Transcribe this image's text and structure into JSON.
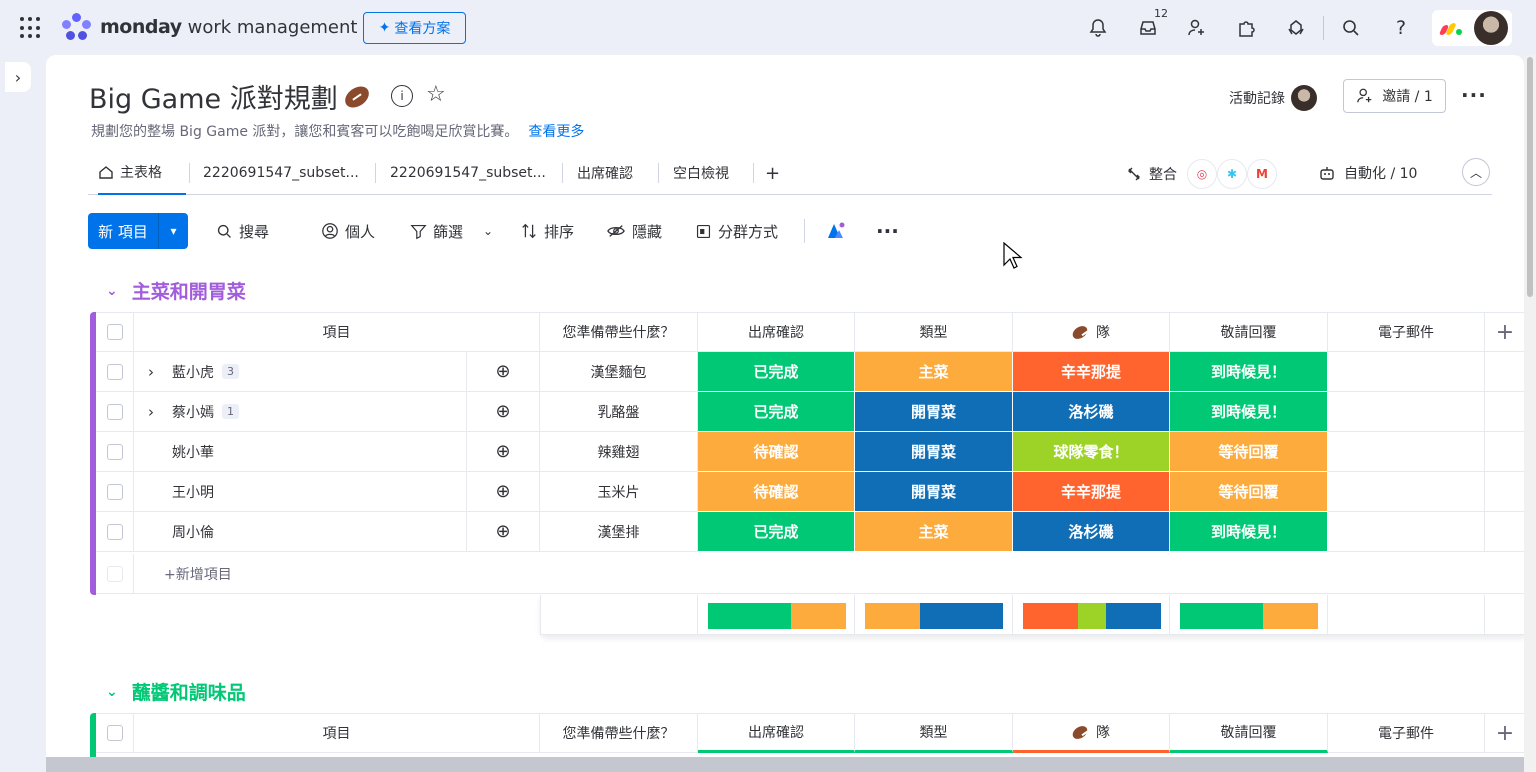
{
  "app": {
    "brand_bold": "monday",
    "brand_rest": "work management",
    "plans_label": "查看方案",
    "inbox_count": "12"
  },
  "board": {
    "title": "Big Game 派對規劃",
    "description": "規劃您的整場 Big Game 派對，讓您和賓客可以吃飽喝足欣賞比賽。",
    "see_more": "查看更多",
    "activity_label": "活動記錄",
    "invite_label": "邀請 / 1"
  },
  "tabs": [
    {
      "label": "主表格"
    },
    {
      "label": "2220691547_subset..."
    },
    {
      "label": "2220691547_subset..."
    },
    {
      "label": "出席確認"
    },
    {
      "label": "空白檢視"
    }
  ],
  "tab_add": "+",
  "integrate_label": "整合",
  "automate_label": "自動化 / 10",
  "toolbar": {
    "new_item": "新 項目",
    "search": "搜尋",
    "person": "個人",
    "filter": "篩選",
    "sort": "排序",
    "hide": "隱藏",
    "group_by": "分群方式"
  },
  "columns": [
    "項目",
    "您準備帶些什麼？",
    "出席確認",
    "類型",
    "隊",
    "敬請回覆",
    "電子郵件"
  ],
  "colors": {
    "green": "#00c875",
    "orange": "#fdab3d",
    "blue": "#0073ea",
    "darkblue": "#0f6eb5",
    "red": "#ff642e",
    "lime": "#9cd326",
    "purple": "#a25ddc"
  },
  "groups": [
    {
      "title": "主菜和開胃菜",
      "color": "#a25ddc",
      "add_item": "+新增項目",
      "rows": [
        {
          "name": "藍小虎",
          "subitems": "3",
          "bring": "漢堡麵包",
          "rsvp": "已完成",
          "type": "主菜",
          "team": "辛辛那提",
          "reply": "到時候見！"
        },
        {
          "name": "蔡小嫣",
          "subitems": "1",
          "bring": "乳酪盤",
          "rsvp": "已完成",
          "type": "開胃菜",
          "team": "洛杉磯",
          "reply": "到時候見！"
        },
        {
          "name": "姚小華",
          "subitems": "",
          "bring": "辣雞翅",
          "rsvp": "待確認",
          "type": "開胃菜",
          "team": "球隊零食！",
          "reply": "等待回覆"
        },
        {
          "name": "王小明",
          "subitems": "",
          "bring": "玉米片",
          "rsvp": "待確認",
          "type": "開胃菜",
          "team": "辛辛那提",
          "reply": "等待回覆"
        },
        {
          "name": "周小倫",
          "subitems": "",
          "bring": "漢堡排",
          "rsvp": "已完成",
          "type": "主菜",
          "team": "洛杉磯",
          "reply": "到時候見！"
        }
      ]
    },
    {
      "title": "蘸醬和調味品",
      "color": "#00c875"
    }
  ]
}
